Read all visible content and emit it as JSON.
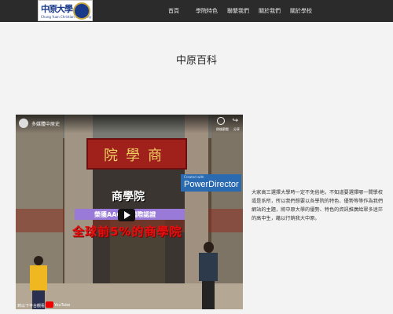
{
  "navbar": {
    "logo_text": "中原大學",
    "logo_subtitle": "Chung Yuan Christian University",
    "items": [
      {
        "label": "首頁"
      },
      {
        "label": "學院特色"
      },
      {
        "label": "聯繫我們"
      },
      {
        "label": "關於我們"
      },
      {
        "label": "關於學校"
      }
    ]
  },
  "page": {
    "title": "中原百科"
  },
  "video": {
    "title": "多媒體中原史",
    "watch_later": "稍後觀看",
    "share": "分享",
    "sign_text": "院學商",
    "headline": "商學院",
    "subheadline": "榮獲AACSB國際認證",
    "red_caption": "全球前5%的商學院",
    "brand_small": "Created with",
    "brand_text": "PowerDirector",
    "bottom_text": "到以下平台觀看",
    "youtube_label": "YouTube"
  },
  "description": "大家高三選擇大學時一定不免俗地，不知道要選擇哪一間學校或是系所，所以我們想要以各學院的特色、優勢等等作為我們網站的主題，將中原大學的優勢、特色的資訊推廣給眾多迷茫的高中生，藉以行銷我大中原。"
}
